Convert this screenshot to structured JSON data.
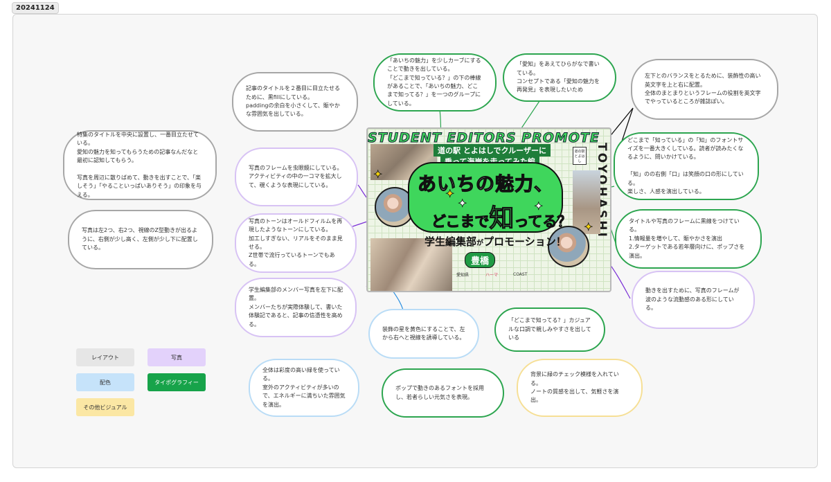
{
  "header": {
    "date_label": "20241124"
  },
  "colors": {
    "gray": "#a6a6a6",
    "purple": "#d7c2f4",
    "green": "#2ca54f",
    "blue": "#b9dcf6",
    "yellow": "#f6df95",
    "connector_black": "#111111",
    "connector_purple": "#7a2fd6",
    "connector_blue": "#2c8fe0",
    "connector_green": "#2ca54f"
  },
  "notes": [
    {
      "id": "layout-feature-title",
      "category": "layout",
      "text": "特集のタイトルを中央に設置し、一番目立たせている。\n愛知の魅力を知ってもらうための記事なんだなと最初に認知してもらう。\n\n写真を周辺に散りばめて、動きを出すことで、「楽しそう」「やることいっぱいありそう」の印象を与える。"
    },
    {
      "id": "layout-photo-placement",
      "category": "layout",
      "text": "写真は左2つ、右2つ、視線のZ型動きが出るように、右側が少し高く、左側が少し下に配置している。"
    },
    {
      "id": "layout-article-title",
      "category": "layout",
      "text": "記事のタイトルを２番目に目立たせるために、黒fillにしている。\npaddingの余白を小さくして、賑やかな雰囲気を出している。"
    },
    {
      "id": "layout-english-text",
      "category": "layout",
      "text": "左下とのバランスをとるために、装飾性の高い英文字を上と右に配置。\n全体のまとまりというフレームの役割を英文字でやっているところが雑誌ぽい。"
    },
    {
      "id": "photo-magnifier",
      "category": "photo",
      "text": "写真のフレームを虫眼鏡にしている。\nアクティビティの中の一コマを拡大して、覗くような表現にしている。"
    },
    {
      "id": "photo-tone",
      "category": "photo",
      "text": "写真のトーンはオールドフィルムを再現したようなトーンにしている。\n加工しすぎない、リアルをそのまま見せる。\nZ世帯で流行っているトーンでもある。"
    },
    {
      "id": "photo-members",
      "category": "photo",
      "text": "学生編集部のメンバー写真を左下に配置。\nメンバーたちが実際体験して、書いた体験記であると、記事の信憑性を高める。"
    },
    {
      "id": "photo-wave-frame",
      "category": "photo",
      "text": "動きを出すために、写真のフレームが波のような流動感のある形にしている。"
    },
    {
      "id": "typo-curve",
      "category": "typography",
      "text": "「あいちの魅力」を少しカーブにすることで動きを出している。\n「どこまで知っている？」の下の棒線があることで、「あいちの魅力、どこまで知ってる？」を一つのグループにしている。"
    },
    {
      "id": "typo-hiragana",
      "category": "typography",
      "text": "「愛知」をあえてひらがなで書いている。\nコンセプトである「愛知の魅力を再発見」を表現したいため"
    },
    {
      "id": "typo-font-size",
      "category": "typography",
      "text": "どこまで「知っている」の「知」のフォントサイズを一番大きくしている。読者が読みたくなるように、問いかけている。\n\n「知」のの右側「口」は笑顔の口の形にしている。\n楽しさ、人感を演出している。"
    },
    {
      "id": "typo-outline",
      "category": "typography",
      "text": "タイトルや写真のフレームに黒線をつけている。\n1.情報量を増やして、賑やかさを演出\n2.ターゲットである若年層向けに、ポップさを演出。"
    },
    {
      "id": "typo-casual",
      "category": "typography",
      "text": "「どこまで知ってる？」カジュアルな口調で親しみやすさを出している"
    },
    {
      "id": "typo-pop-font",
      "category": "typography",
      "text": "ポップで動きのあるフォントを採用し、若者らしい元気さを表現。"
    },
    {
      "id": "color-stars",
      "category": "color",
      "text": "装飾の星を黄色にすることで、左から右へと視線を誘導している。"
    },
    {
      "id": "color-saturation",
      "category": "color",
      "text": "全体は彩度の高い緑を使っている。\n室外のアクティビティが多いので、エネルギーに満ちいた雰囲気を演出。"
    },
    {
      "id": "visual-check-pattern",
      "category": "other",
      "text": "背景に緑のチェック模様を入れている。\nノートの質感を出して、気軽さを演出。"
    }
  ],
  "legend": [
    {
      "id": "layout",
      "label": "レイアウト",
      "bg": "#e6e6e6",
      "fg": "#333333"
    },
    {
      "id": "photo",
      "label": "写真",
      "bg": "#e3d2fb",
      "fg": "#333333"
    },
    {
      "id": "color",
      "label": "配色",
      "bg": "#c6e3fa",
      "fg": "#333333"
    },
    {
      "id": "typography",
      "label": "タイポグラフィー",
      "bg": "#17a34a",
      "fg": "#ffffff"
    },
    {
      "id": "other",
      "label": "その他ビジュアル",
      "bg": "#fbe7a4",
      "fg": "#333333"
    }
  ],
  "poster": {
    "banner": "STUDENT EDITORS PROMOTE",
    "side_text": "TOYOHASHI",
    "subtitle_1": "道の駅 とよはしでクルーザーに",
    "subtitle_2": "乗って海岸を走ってみた編",
    "title_1": "あいちの魅力、",
    "title_2a": "どこまで",
    "title_2b": "知",
    "title_2c": "ってる？",
    "promo_a": "学生編集部",
    "promo_b": "が",
    "promo_c": "プロモーション！",
    "city": "豊橋",
    "doc_icon_label": "道の駅\nとよはし",
    "logos": [
      "愛知県",
      "ハーマ",
      "COAST"
    ]
  }
}
